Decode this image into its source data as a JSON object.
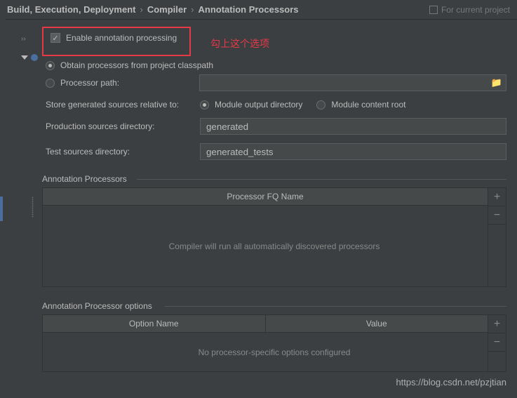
{
  "breadcrumb": {
    "item1": "Build, Execution, Deployment",
    "item2": "Compiler",
    "item3": "Annotation Processors"
  },
  "forProject": "For current project",
  "collapseBtn": "››",
  "enableCheckbox": "Enable annotation processing",
  "annotation": "勾上这个选项",
  "radio1": "Obtain processors from project classpath",
  "radio2": "Processor path:",
  "storeLabel": "Store generated sources relative to:",
  "radio3": "Module output directory",
  "radio4": "Module content root",
  "prodLabel": "Production sources directory:",
  "prodValue": "generated",
  "testLabel": "Test sources directory:",
  "testValue": "generated_tests",
  "section1": "Annotation Processors",
  "table1Header": "Processor FQ Name",
  "table1Empty": "Compiler will run all automatically discovered processors",
  "section2": "Annotation Processor options",
  "table2Col1": "Option Name",
  "table2Col2": "Value",
  "table2Empty": "No processor-specific options configured",
  "plusBtn": "+",
  "minusBtn": "−",
  "watermark": "https://blog.csdn.net/pzjtian"
}
